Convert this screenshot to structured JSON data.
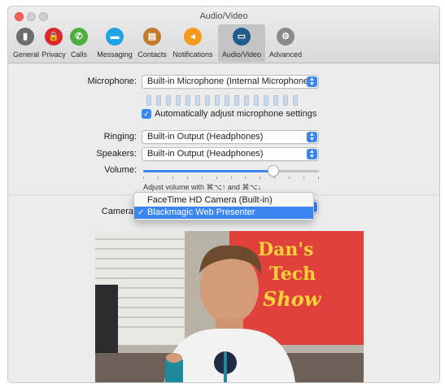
{
  "window": {
    "title": "Audio/Video"
  },
  "toolbar": {
    "items": [
      {
        "label": "General",
        "icon": "general-icon",
        "color": "#6d6d6d",
        "glyph": "▮"
      },
      {
        "label": "Privacy",
        "icon": "lock-icon",
        "color": "#e0262f",
        "glyph": "🔒"
      },
      {
        "label": "Calls",
        "icon": "phone-icon",
        "color": "#4fae3f",
        "glyph": "✆"
      },
      {
        "label": "Messaging",
        "icon": "chat-bubble-icon",
        "color": "#1ea4e0",
        "glyph": "▬"
      },
      {
        "label": "Contacts",
        "icon": "contacts-book-icon",
        "color": "#c27a2d",
        "glyph": "▤"
      },
      {
        "label": "Notifications",
        "icon": "megaphone-icon",
        "color": "#f59a1b",
        "glyph": "◂"
      },
      {
        "label": "Audio/Video",
        "icon": "monitor-icon",
        "color": "#1f5b8c",
        "glyph": "▭"
      },
      {
        "label": "Advanced",
        "icon": "gear-icon",
        "color": "#8a8a8a",
        "glyph": "⚙"
      }
    ],
    "selected": "Audio/Video"
  },
  "microphone": {
    "label": "Microphone:",
    "value": "Built-in Microphone (Internal Microphone)",
    "auto_adjust_label": "Automatically adjust microphone settings",
    "auto_adjust_checked": true
  },
  "ringing": {
    "label": "Ringing:",
    "value": "Built-in Output (Headphones)"
  },
  "speakers": {
    "label": "Speakers:",
    "value": "Built-in Output (Headphones)"
  },
  "volume": {
    "label": "Volume:",
    "level": 0.74,
    "hint": "Adjust volume with ⌘⌥↑ and ⌘⌥↓"
  },
  "camera": {
    "label": "Camera",
    "options": [
      "FaceTime HD Camera (Built-in)",
      "Blackmagic Web Presenter"
    ],
    "selected": "Blackmagic Web Presenter"
  },
  "preview": {
    "sign_text_1": "Dan's",
    "sign_text_2": "Tech",
    "sign_text_3": "Show"
  },
  "colors": {
    "accent": "#3b86f1",
    "sign_red": "#e0413a",
    "sign_yellow": "#f5d23a"
  }
}
